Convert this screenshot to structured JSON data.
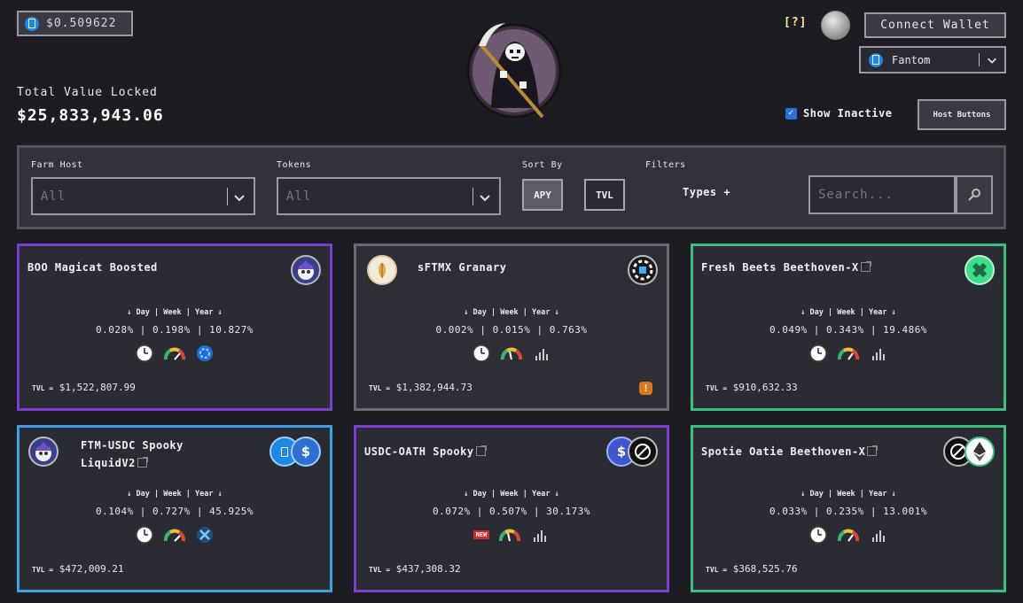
{
  "header": {
    "price": "$0.509622",
    "tvl_label": "Total Value Locked",
    "tvl_value": "$25,833,943.06",
    "help": "[?]",
    "connect_wallet": "Connect Wallet",
    "chain": "Fantom",
    "show_inactive": "Show Inactive",
    "host_buttons": "Host Buttons"
  },
  "filters": {
    "farm_host_label": "Farm Host",
    "farm_host_value": "All",
    "tokens_label": "Tokens",
    "tokens_value": "All",
    "sort_by_label": "Sort By",
    "sort_apy": "APY",
    "sort_tvl": "TVL",
    "filters_label": "Filters",
    "types": "Types +",
    "search_placeholder": "Search..."
  },
  "periods": "↓ Day | Week | Year ↓",
  "tvl_prefix": "TVL =",
  "cards": [
    {
      "title": "BOO Magicat Boosted",
      "rates": "0.028% | 0.198% | 10.827%",
      "tvl": "$1,522,807.99",
      "border": "#7b3fd0"
    },
    {
      "title": "sFTMX Granary",
      "rates": "0.002% | 0.015% | 0.763%",
      "tvl": "$1,382,944.73",
      "border": "#6b6b73"
    },
    {
      "title": "Fresh Beets Beethoven-X",
      "rates": "0.049% | 0.343% | 19.486%",
      "tvl": "$910,632.33",
      "border": "#3fbf7f"
    },
    {
      "title_line1": "FTM-USDC Spooky",
      "title_line2": "LiquidV2",
      "rates": "0.104% | 0.727% | 45.925%",
      "tvl": "$472,009.21",
      "border": "#3f9fe0"
    },
    {
      "title": "USDC-OATH Spooky",
      "rates": "0.072% | 0.507% | 30.173%",
      "tvl": "$437,308.32",
      "border": "#7b3fd0",
      "badge": "NEW"
    },
    {
      "title": "Spotie Oatie Beethoven-X",
      "rates": "0.033% | 0.235% | 13.001%",
      "tvl": "$368,525.76",
      "border": "#3fbf7f"
    }
  ]
}
